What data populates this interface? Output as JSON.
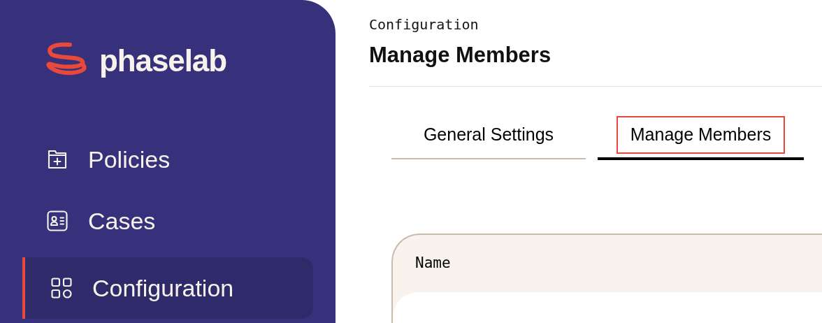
{
  "sidebar": {
    "logo": "phaselab",
    "items": [
      {
        "label": "Policies",
        "selected": false
      },
      {
        "label": "Cases",
        "selected": false
      },
      {
        "label": "Configuration",
        "selected": true
      }
    ]
  },
  "header": {
    "breadcrumb": "Configuration",
    "title": "Manage Members"
  },
  "tabs": [
    {
      "label": "General Settings",
      "selected": false,
      "highlighted": false
    },
    {
      "label": "Manage Members",
      "selected": true,
      "highlighted": true
    }
  ],
  "table": {
    "columns": [
      "Name"
    ]
  }
}
